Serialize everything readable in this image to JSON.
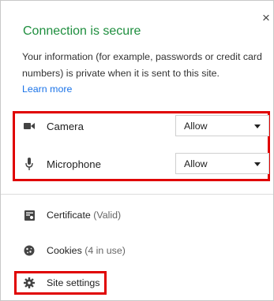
{
  "header": {
    "title": "Connection is secure",
    "description": "Your information (for example, passwords or credit card numbers) is private when it is sent to this site.",
    "learn_more": "Learn more",
    "close_glyph": "×"
  },
  "permissions": [
    {
      "label": "Camera",
      "value": "Allow",
      "icon": "camera-icon"
    },
    {
      "label": "Microphone",
      "value": "Allow",
      "icon": "microphone-icon"
    }
  ],
  "info": {
    "certificate": {
      "label": "Certificate",
      "status": "(Valid)",
      "icon": "certificate-icon"
    },
    "cookies": {
      "label": "Cookies",
      "status": "(4 in use)",
      "icon": "cookie-icon"
    },
    "site_settings": {
      "label": "Site settings",
      "icon": "gear-icon"
    }
  },
  "colors": {
    "title_green": "#1e8e3e",
    "link_blue": "#1a73e8",
    "highlight_red": "#e00000"
  }
}
